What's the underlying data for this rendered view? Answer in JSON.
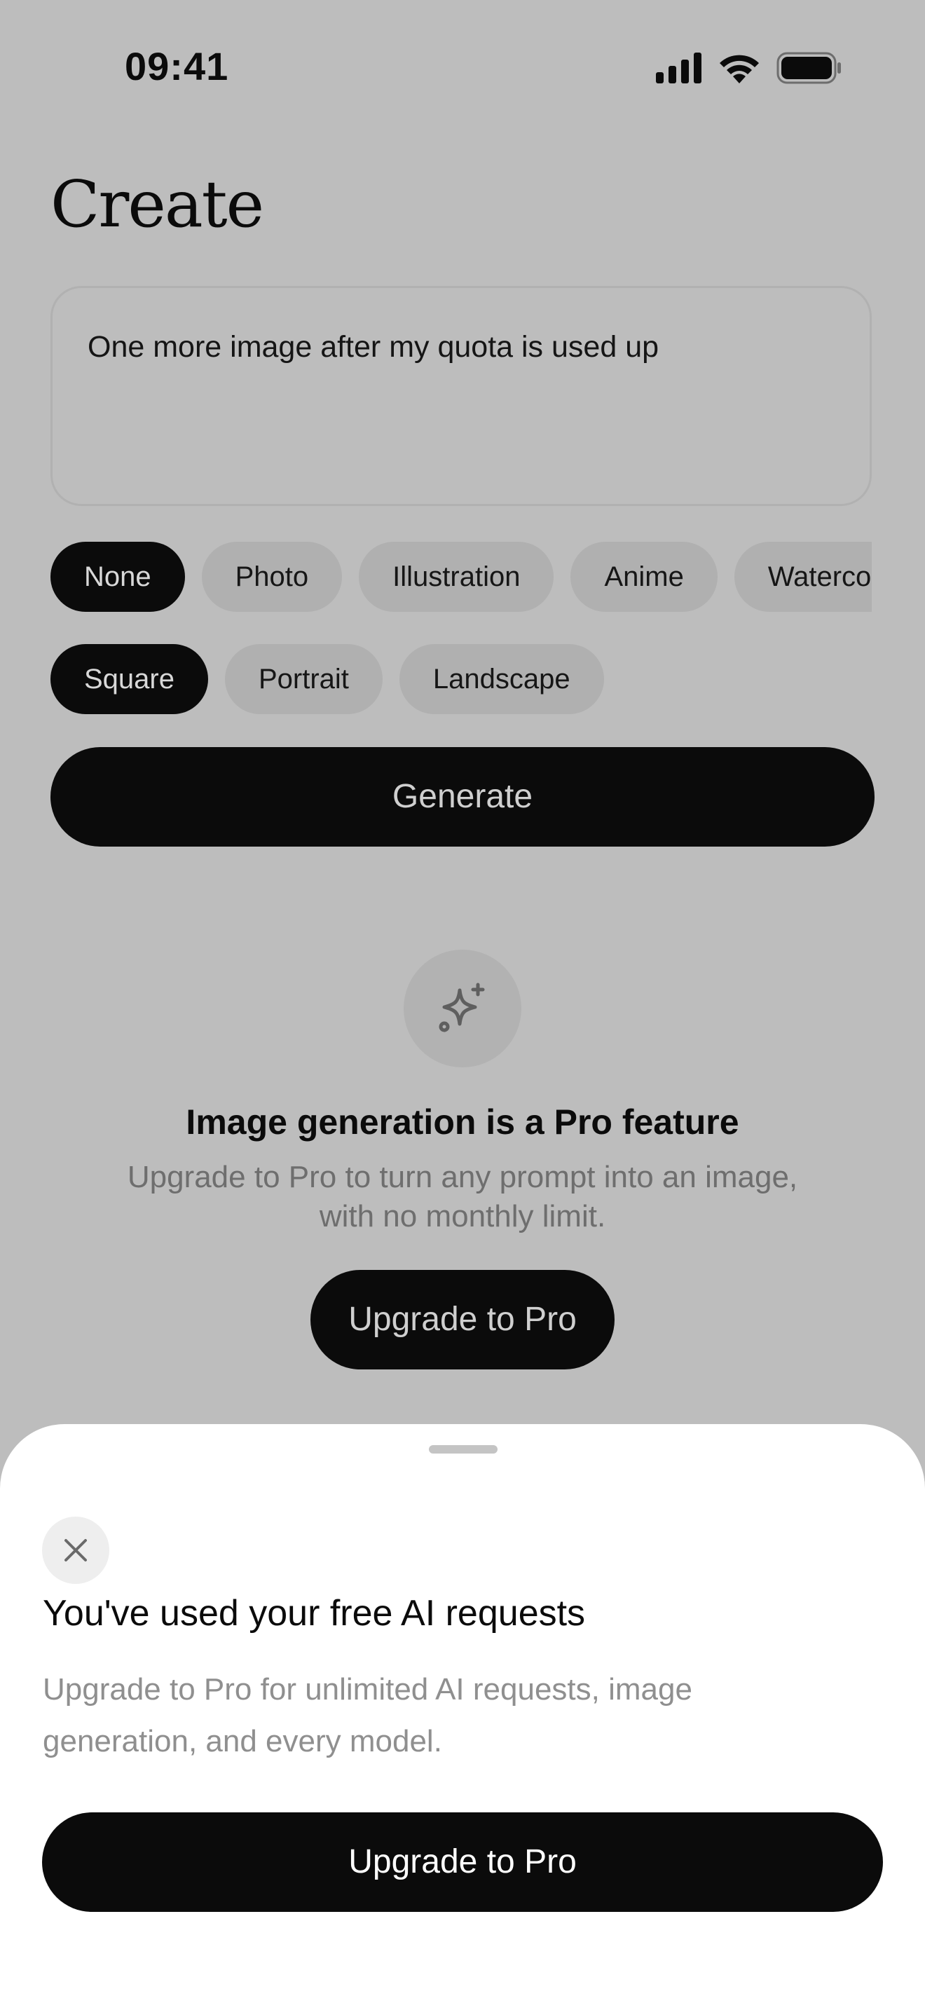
{
  "status_bar": {
    "time": "09:41",
    "icons": [
      "signal-icon",
      "wifi-icon",
      "battery-icon"
    ]
  },
  "page": {
    "title": "Create"
  },
  "prompt": {
    "value": "One more image after my quota is used up"
  },
  "styles": {
    "options": [
      "None",
      "Photo",
      "Illustration",
      "Anime",
      "Watercolor"
    ],
    "selected": "None"
  },
  "aspect": {
    "options": [
      "Square",
      "Portrait",
      "Landscape"
    ],
    "selected": "Square"
  },
  "generate": {
    "label": "Generate"
  },
  "pro_feature": {
    "icon": "sparkle-icon",
    "heading": "Image generation is a Pro feature",
    "description_line1": "Upgrade to Pro to turn any prompt into an image,",
    "description_line2": "with no monthly limit.",
    "button_label": "Upgrade to Pro"
  },
  "sheet": {
    "close_icon": "close-icon",
    "title": "You've used your free AI requests",
    "description_line1": "Upgrade to Pro for unlimited AI requests, image",
    "description_line2": "generation, and every model.",
    "button_label": "Upgrade to Pro"
  },
  "colors": {
    "scrim_background": "#bdbdbd",
    "primary_button": "#0b0b0b",
    "sheet_background": "#ffffff",
    "muted_text": "#8f8f8f"
  }
}
